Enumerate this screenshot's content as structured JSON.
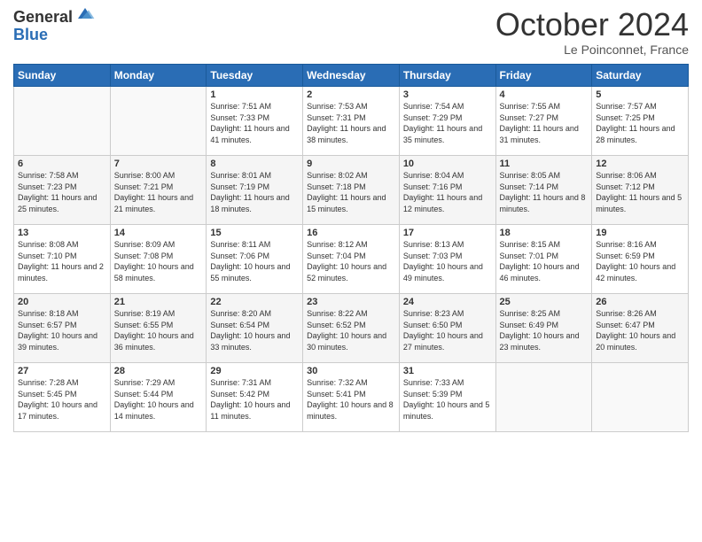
{
  "header": {
    "logo_general": "General",
    "logo_blue": "Blue",
    "month_title": "October 2024",
    "location": "Le Poinconnet, France"
  },
  "weekdays": [
    "Sunday",
    "Monday",
    "Tuesday",
    "Wednesday",
    "Thursday",
    "Friday",
    "Saturday"
  ],
  "weeks": [
    [
      {
        "day": "",
        "sunrise": "",
        "sunset": "",
        "daylight": ""
      },
      {
        "day": "",
        "sunrise": "",
        "sunset": "",
        "daylight": ""
      },
      {
        "day": "1",
        "sunrise": "Sunrise: 7:51 AM",
        "sunset": "Sunset: 7:33 PM",
        "daylight": "Daylight: 11 hours and 41 minutes."
      },
      {
        "day": "2",
        "sunrise": "Sunrise: 7:53 AM",
        "sunset": "Sunset: 7:31 PM",
        "daylight": "Daylight: 11 hours and 38 minutes."
      },
      {
        "day": "3",
        "sunrise": "Sunrise: 7:54 AM",
        "sunset": "Sunset: 7:29 PM",
        "daylight": "Daylight: 11 hours and 35 minutes."
      },
      {
        "day": "4",
        "sunrise": "Sunrise: 7:55 AM",
        "sunset": "Sunset: 7:27 PM",
        "daylight": "Daylight: 11 hours and 31 minutes."
      },
      {
        "day": "5",
        "sunrise": "Sunrise: 7:57 AM",
        "sunset": "Sunset: 7:25 PM",
        "daylight": "Daylight: 11 hours and 28 minutes."
      }
    ],
    [
      {
        "day": "6",
        "sunrise": "Sunrise: 7:58 AM",
        "sunset": "Sunset: 7:23 PM",
        "daylight": "Daylight: 11 hours and 25 minutes."
      },
      {
        "day": "7",
        "sunrise": "Sunrise: 8:00 AM",
        "sunset": "Sunset: 7:21 PM",
        "daylight": "Daylight: 11 hours and 21 minutes."
      },
      {
        "day": "8",
        "sunrise": "Sunrise: 8:01 AM",
        "sunset": "Sunset: 7:19 PM",
        "daylight": "Daylight: 11 hours and 18 minutes."
      },
      {
        "day": "9",
        "sunrise": "Sunrise: 8:02 AM",
        "sunset": "Sunset: 7:18 PM",
        "daylight": "Daylight: 11 hours and 15 minutes."
      },
      {
        "day": "10",
        "sunrise": "Sunrise: 8:04 AM",
        "sunset": "Sunset: 7:16 PM",
        "daylight": "Daylight: 11 hours and 12 minutes."
      },
      {
        "day": "11",
        "sunrise": "Sunrise: 8:05 AM",
        "sunset": "Sunset: 7:14 PM",
        "daylight": "Daylight: 11 hours and 8 minutes."
      },
      {
        "day": "12",
        "sunrise": "Sunrise: 8:06 AM",
        "sunset": "Sunset: 7:12 PM",
        "daylight": "Daylight: 11 hours and 5 minutes."
      }
    ],
    [
      {
        "day": "13",
        "sunrise": "Sunrise: 8:08 AM",
        "sunset": "Sunset: 7:10 PM",
        "daylight": "Daylight: 11 hours and 2 minutes."
      },
      {
        "day": "14",
        "sunrise": "Sunrise: 8:09 AM",
        "sunset": "Sunset: 7:08 PM",
        "daylight": "Daylight: 10 hours and 58 minutes."
      },
      {
        "day": "15",
        "sunrise": "Sunrise: 8:11 AM",
        "sunset": "Sunset: 7:06 PM",
        "daylight": "Daylight: 10 hours and 55 minutes."
      },
      {
        "day": "16",
        "sunrise": "Sunrise: 8:12 AM",
        "sunset": "Sunset: 7:04 PM",
        "daylight": "Daylight: 10 hours and 52 minutes."
      },
      {
        "day": "17",
        "sunrise": "Sunrise: 8:13 AM",
        "sunset": "Sunset: 7:03 PM",
        "daylight": "Daylight: 10 hours and 49 minutes."
      },
      {
        "day": "18",
        "sunrise": "Sunrise: 8:15 AM",
        "sunset": "Sunset: 7:01 PM",
        "daylight": "Daylight: 10 hours and 46 minutes."
      },
      {
        "day": "19",
        "sunrise": "Sunrise: 8:16 AM",
        "sunset": "Sunset: 6:59 PM",
        "daylight": "Daylight: 10 hours and 42 minutes."
      }
    ],
    [
      {
        "day": "20",
        "sunrise": "Sunrise: 8:18 AM",
        "sunset": "Sunset: 6:57 PM",
        "daylight": "Daylight: 10 hours and 39 minutes."
      },
      {
        "day": "21",
        "sunrise": "Sunrise: 8:19 AM",
        "sunset": "Sunset: 6:55 PM",
        "daylight": "Daylight: 10 hours and 36 minutes."
      },
      {
        "day": "22",
        "sunrise": "Sunrise: 8:20 AM",
        "sunset": "Sunset: 6:54 PM",
        "daylight": "Daylight: 10 hours and 33 minutes."
      },
      {
        "day": "23",
        "sunrise": "Sunrise: 8:22 AM",
        "sunset": "Sunset: 6:52 PM",
        "daylight": "Daylight: 10 hours and 30 minutes."
      },
      {
        "day": "24",
        "sunrise": "Sunrise: 8:23 AM",
        "sunset": "Sunset: 6:50 PM",
        "daylight": "Daylight: 10 hours and 27 minutes."
      },
      {
        "day": "25",
        "sunrise": "Sunrise: 8:25 AM",
        "sunset": "Sunset: 6:49 PM",
        "daylight": "Daylight: 10 hours and 23 minutes."
      },
      {
        "day": "26",
        "sunrise": "Sunrise: 8:26 AM",
        "sunset": "Sunset: 6:47 PM",
        "daylight": "Daylight: 10 hours and 20 minutes."
      }
    ],
    [
      {
        "day": "27",
        "sunrise": "Sunrise: 7:28 AM",
        "sunset": "Sunset: 5:45 PM",
        "daylight": "Daylight: 10 hours and 17 minutes."
      },
      {
        "day": "28",
        "sunrise": "Sunrise: 7:29 AM",
        "sunset": "Sunset: 5:44 PM",
        "daylight": "Daylight: 10 hours and 14 minutes."
      },
      {
        "day": "29",
        "sunrise": "Sunrise: 7:31 AM",
        "sunset": "Sunset: 5:42 PM",
        "daylight": "Daylight: 10 hours and 11 minutes."
      },
      {
        "day": "30",
        "sunrise": "Sunrise: 7:32 AM",
        "sunset": "Sunset: 5:41 PM",
        "daylight": "Daylight: 10 hours and 8 minutes."
      },
      {
        "day": "31",
        "sunrise": "Sunrise: 7:33 AM",
        "sunset": "Sunset: 5:39 PM",
        "daylight": "Daylight: 10 hours and 5 minutes."
      },
      {
        "day": "",
        "sunrise": "",
        "sunset": "",
        "daylight": ""
      },
      {
        "day": "",
        "sunrise": "",
        "sunset": "",
        "daylight": ""
      }
    ]
  ]
}
